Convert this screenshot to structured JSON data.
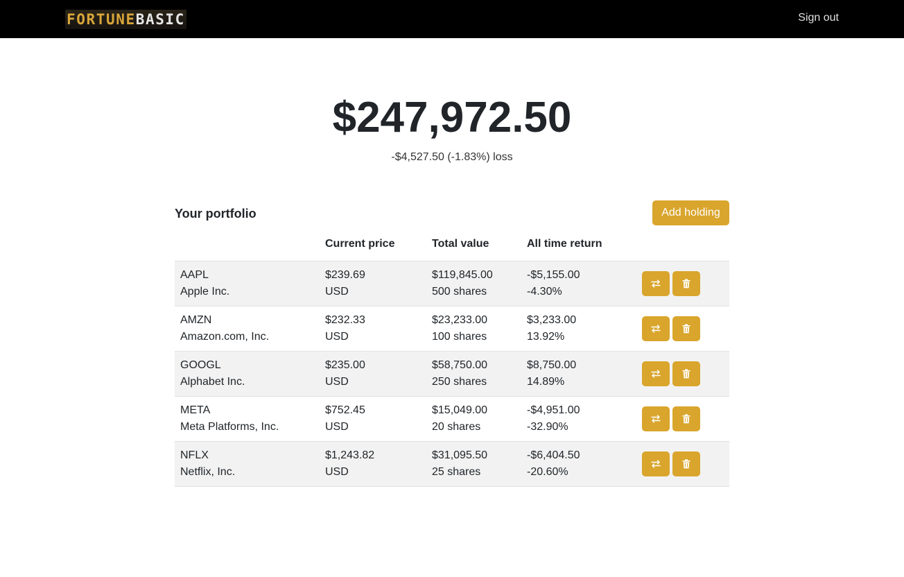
{
  "navbar": {
    "logo_part1": "FORTUNE",
    "logo_part2": "BASIC",
    "signout_label": "Sign out"
  },
  "summary": {
    "total_value": "$247,972.50",
    "change_text": "-$4,527.50 (-1.83%) loss"
  },
  "portfolio": {
    "title": "Your portfolio",
    "add_button_label": "Add holding",
    "columns": [
      "",
      "Current price",
      "Total value",
      "All time return",
      ""
    ],
    "holdings": [
      {
        "symbol": "AAPL",
        "name": "Apple Inc.",
        "price": "$239.69",
        "currency": "USD",
        "total_value": "$119,845.00",
        "shares": "500 shares",
        "return_value": "-$5,155.00",
        "return_pct": "-4.30%"
      },
      {
        "symbol": "AMZN",
        "name": "Amazon.com, Inc.",
        "price": "$232.33",
        "currency": "USD",
        "total_value": "$23,233.00",
        "shares": "100 shares",
        "return_value": "$3,233.00",
        "return_pct": "13.92%"
      },
      {
        "symbol": "GOOGL",
        "name": "Alphabet Inc.",
        "price": "$235.00",
        "currency": "USD",
        "total_value": "$58,750.00",
        "shares": "250 shares",
        "return_value": "$8,750.00",
        "return_pct": "14.89%"
      },
      {
        "symbol": "META",
        "name": "Meta Platforms, Inc.",
        "price": "$752.45",
        "currency": "USD",
        "total_value": "$15,049.00",
        "shares": "20 shares",
        "return_value": "-$4,951.00",
        "return_pct": "-32.90%"
      },
      {
        "symbol": "NFLX",
        "name": "Netflix, Inc.",
        "price": "$1,243.82",
        "currency": "USD",
        "total_value": "$31,095.50",
        "shares": "25 shares",
        "return_value": "-$6,404.50",
        "return_pct": "-20.60%"
      }
    ],
    "row_actions": [
      {
        "icon": "transfer-icon"
      },
      {
        "icon": "trash-icon"
      }
    ]
  },
  "colors": {
    "accent": "#d9a52c",
    "navbar_bg": "#000000",
    "row_stripe": "#f2f2f2"
  }
}
